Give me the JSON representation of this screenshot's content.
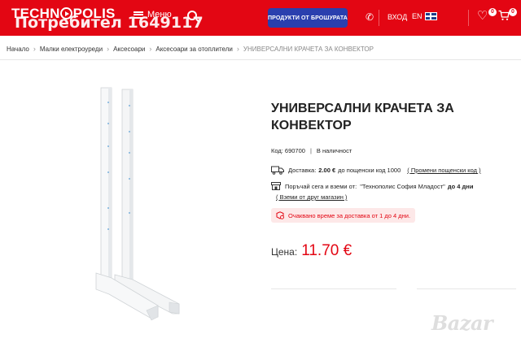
{
  "header": {
    "logo_left": "TECHN",
    "logo_right": "POLIS",
    "overlay_text": "Потребител 1649117",
    "menu_label": "Меню",
    "brochure_button": "ПРОДУКТИ ОТ БРОШУРАТА",
    "login_label": "ВХОД",
    "language_label": "EN",
    "wishlist_count": "0",
    "cart_count": "0",
    "brand_color": "#e30613",
    "button_color": "#2a3fae"
  },
  "breadcrumb": {
    "items": [
      "Начало",
      "Малки електроуреди",
      "Аксесоари",
      "Аксесоари за отоплители"
    ],
    "current": "УНИВЕРСАЛНИ КРАЧЕТА ЗА КОНВЕКТОР"
  },
  "product": {
    "title": "УНИВЕРСАЛНИ КРАЧЕТА ЗА КОНВЕКТОР",
    "code": "Код: 690700",
    "availability": "В наличност",
    "delivery": {
      "label": "Доставка:",
      "price": "2.00 €",
      "postcode_text": "до пощенски код 1000",
      "change_link": "( Промени пощенски код )"
    },
    "pickup": {
      "label": "Поръчай сега и вземи от:",
      "store": "\"Технополис София Младост\"",
      "days": "до 4 дни",
      "other_store_link": "( Вземи от друг магазин )"
    },
    "eta_text": "Очаквано време за доставка от 1 до 4 дни.",
    "price_label": "Цена:",
    "price_value": "11.70 €"
  },
  "watermark": "Bazar"
}
